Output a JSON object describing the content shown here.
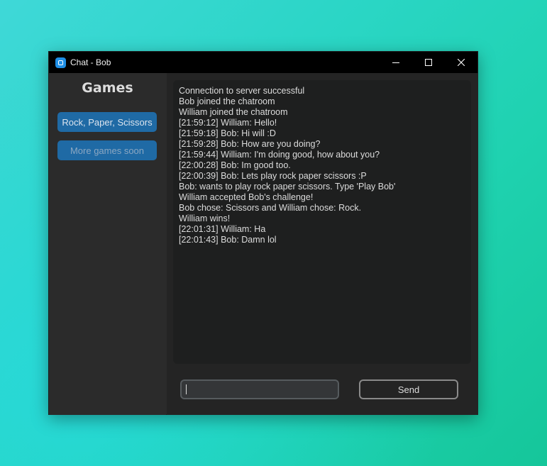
{
  "window": {
    "title": "Chat - Bob"
  },
  "sidebar": {
    "title": "Games",
    "buttons": [
      {
        "label": "Rock, Paper, Scissors",
        "enabled": true
      },
      {
        "label": "More games soon",
        "enabled": false
      }
    ]
  },
  "chat": {
    "lines": [
      "Connection to server successful",
      "Bob joined the chatroom",
      "William joined the chatroom",
      "[21:59:12] William: Hello!",
      "[21:59:18] Bob: Hi will :D",
      "[21:59:28] Bob: How are you doing?",
      "[21:59:44] William: I'm doing good, how about you?",
      "[22:00:28] Bob: Im good too.",
      "[22:00:39] Bob: Lets play rock paper scissors :P",
      "Bob: wants to play rock paper scissors. Type 'Play Bob'",
      "William accepted Bob's challenge!",
      "Bob chose: Scissors and William chose: Rock.",
      "William wins!",
      "[22:01:31] William: Ha",
      "[22:01:43] Bob: Damn lol"
    ]
  },
  "input": {
    "value": "",
    "send_label": "Send"
  },
  "colors": {
    "accent": "#1f6aa5",
    "titlebar": "#000000",
    "window_bg": "#2b2b2b",
    "chat_bg": "#1e1f1f"
  }
}
